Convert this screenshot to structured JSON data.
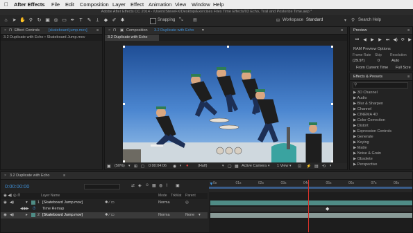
{
  "menubar": {
    "apple": "",
    "app_name": "After Effects",
    "items": [
      "File",
      "Edit",
      "Composition",
      "Layer",
      "Effect",
      "Animation",
      "View",
      "Window",
      "Help"
    ]
  },
  "titlebar": {
    "title": "Adobe After Effects CC 2014 - /Users/SteveFX/Desktop/Exercises Files Time Effects/03 Echo, Trail and Posterize Time.aep *"
  },
  "toolbar": {
    "snapping_label": "Snapping",
    "workspace_label": "Workspace",
    "workspace_value": "Standard",
    "search_placeholder": "Search Help"
  },
  "effect_controls": {
    "tab_label": "Effect Controls",
    "tab_target": "[skateboard jump.mov]",
    "subtitle": "3.2 Duplicate with Echo • Skateboard Jump.mov"
  },
  "composition": {
    "tab_label": "Composition",
    "tab_target": "3.2 Duplicate with Echo",
    "breadcrumb": "3.2 Duplicate with Echo",
    "footer": {
      "zoom": "(50%)",
      "timecode": "0:00:04:06",
      "resolution": "(Half)",
      "camera": "Active Camera",
      "views": "1 View"
    }
  },
  "preview": {
    "tab_label": "Preview",
    "ram_options": "RAM Preview Options",
    "col_frame_rate": "Frame Rate",
    "col_skip": "Skip",
    "col_resolution": "Resolution",
    "frame_rate_value": "(29.97)",
    "skip_value": "0",
    "resolution_value": "Auto",
    "from_current": "From Current Time",
    "full_screen": "Full Scre"
  },
  "effects_presets": {
    "tab_label": "Effects & Presets",
    "search_placeholder": "",
    "items": [
      "3D Channel",
      "Audio",
      "Blur & Sharpen",
      "Channel",
      "CINEMA 4D",
      "Color Correction",
      "Distort",
      "Expression Controls",
      "Generate",
      "Keying",
      "Matte",
      "Noise & Grain",
      "Obsolete",
      "Perspective"
    ]
  },
  "timeline": {
    "tab_label": "3.2 Duplicate with Echo",
    "timecode": "0:00:00:00",
    "col_layer_name": "Layer Name",
    "col_mode": "Mode",
    "col_trkmat": "TrkMat",
    "col_parent": "Parent",
    "ruler_ticks": [
      "0s",
      "01s",
      "02s",
      "03s",
      "04s",
      "05s",
      "06s",
      "07s",
      "08s"
    ],
    "layers": [
      {
        "num": "1",
        "name": "[Skateboard Jump.mov]",
        "mode": "Norma",
        "trkmat": "",
        "parent": ""
      },
      {
        "num": "",
        "name": "Time Remap",
        "mode": "",
        "trkmat": "",
        "parent": ""
      },
      {
        "num": "2",
        "name": "[Skateboard Jump.mov]",
        "mode": "Norma",
        "trkmat": "None",
        "parent": ""
      }
    ],
    "playhead_seconds": 4.2
  },
  "colors": {
    "accent_blue": "#3f8fd6",
    "layer_bar_teal": "#4f8c86",
    "layer_bar_gray": "#6e6e6e",
    "playhead_red": "#d8322a"
  }
}
